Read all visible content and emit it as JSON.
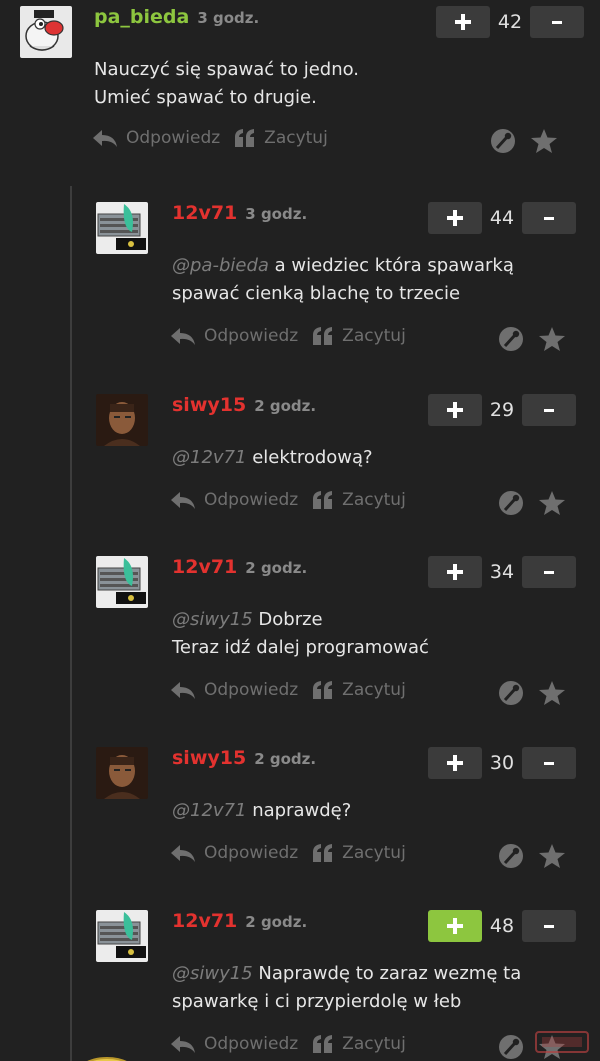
{
  "colors": {
    "background": "#212121",
    "username_green": "#8dc63f",
    "username_red": "#e3322f",
    "muted": "#7c7c7c",
    "upvote_active": "#8dc63f"
  },
  "actions": {
    "reply_label": "Odpowiedz",
    "quote_label": "Zacytuj",
    "reply_icon": "reply-arrow-icon",
    "quote_icon": "quote-icon",
    "tools_icon": "wrench-icon",
    "star_icon": "star-icon"
  },
  "comments": [
    {
      "author": "pa_bieda",
      "time": "3 godz.",
      "score": "42",
      "mention": "",
      "lines": [
        "Nauczyć się spawać to jedno.",
        "Umieć spawać to drugie."
      ],
      "author_color": "green"
    },
    {
      "author": "12v71",
      "time": "3 godz.",
      "score": "44",
      "mention": "@pa-bieda",
      "lines": [
        " a wiedziec która spawarką",
        "spawać cienką blachę to trzecie"
      ],
      "author_color": "red"
    },
    {
      "author": "siwy15",
      "time": "2 godz.",
      "score": "29",
      "mention": "@12v71",
      "lines": [
        " elektrodową?"
      ],
      "author_color": "red"
    },
    {
      "author": "12v71",
      "time": "2 godz.",
      "score": "34",
      "mention": "@siwy15",
      "lines": [
        " Dobrze",
        "Teraz idź dalej programować"
      ],
      "author_color": "red"
    },
    {
      "author": "siwy15",
      "time": "2 godz.",
      "score": "30",
      "mention": "@12v71",
      "lines": [
        " naprawdę?"
      ],
      "author_color": "red"
    },
    {
      "author": "12v71",
      "time": "2 godz.",
      "score": "48",
      "mention": "@siwy15",
      "lines": [
        " Naprawdę to zaraz wezmę ta",
        "spawarkę i ci przypierdolę w łeb"
      ],
      "author_color": "red",
      "upvoted": true
    }
  ]
}
